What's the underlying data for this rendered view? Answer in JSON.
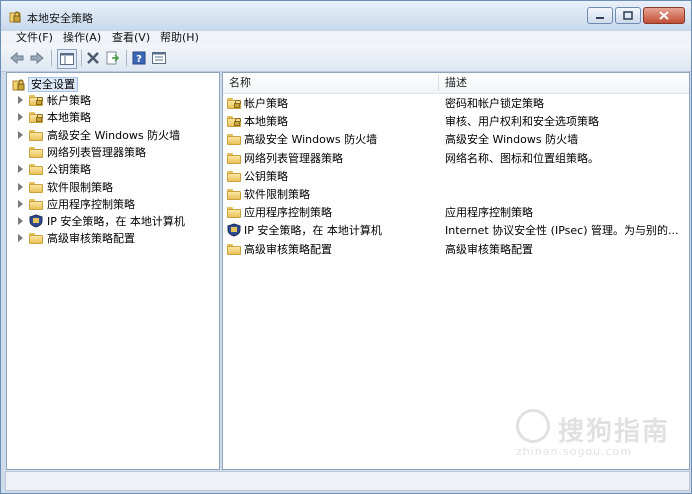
{
  "window": {
    "title": "本地安全策略",
    "accent": "#6b8fb4"
  },
  "menu": [
    "文件(F)",
    "操作(A)",
    "查看(V)",
    "帮助(H)"
  ],
  "toolbar": {
    "icons": [
      "back-arrow-icon",
      "forward-arrow-icon",
      "show-console-tree-icon",
      "delete-icon",
      "export-list-icon",
      "help-icon",
      "properties-icon"
    ]
  },
  "tree": {
    "root": "安全设置",
    "items": [
      {
        "label": "帐户策略",
        "type": "lock-folder",
        "expandable": true
      },
      {
        "label": "本地策略",
        "type": "lock-folder",
        "expandable": true
      },
      {
        "label": "高级安全 Windows 防火墙",
        "type": "folder",
        "expandable": true
      },
      {
        "label": "网络列表管理器策略",
        "type": "folder",
        "expandable": false
      },
      {
        "label": "公钥策略",
        "type": "folder",
        "expandable": true
      },
      {
        "label": "软件限制策略",
        "type": "folder",
        "expandable": true
      },
      {
        "label": "应用程序控制策略",
        "type": "folder",
        "expandable": true
      },
      {
        "label": "IP 安全策略，在 本地计算机",
        "type": "shield",
        "expandable": true
      },
      {
        "label": "高级审核策略配置",
        "type": "folder",
        "expandable": true
      }
    ]
  },
  "list": {
    "columns": [
      "名称",
      "描述"
    ],
    "rows": [
      {
        "name": "帐户策略",
        "desc": "密码和帐户锁定策略",
        "type": "lock-folder"
      },
      {
        "name": "本地策略",
        "desc": "审核、用户权利和安全选项策略",
        "type": "lock-folder"
      },
      {
        "name": "高级安全 Windows 防火墙",
        "desc": "高级安全 Windows 防火墙",
        "type": "folder"
      },
      {
        "name": "网络列表管理器策略",
        "desc": "网络名称、图标和位置组策略。",
        "type": "folder"
      },
      {
        "name": "公钥策略",
        "desc": "",
        "type": "folder"
      },
      {
        "name": "软件限制策略",
        "desc": "",
        "type": "folder"
      },
      {
        "name": "应用程序控制策略",
        "desc": "应用程序控制策略",
        "type": "folder"
      },
      {
        "name": "IP 安全策略，在 本地计算机",
        "desc": "Internet 协议安全性 (IPsec) 管理。为与别的...",
        "type": "shield"
      },
      {
        "name": "高级审核策略配置",
        "desc": "高级审核策略配置",
        "type": "folder"
      }
    ]
  },
  "watermark": {
    "text": "搜狗指南",
    "url": "zhinan.sogou.com"
  }
}
